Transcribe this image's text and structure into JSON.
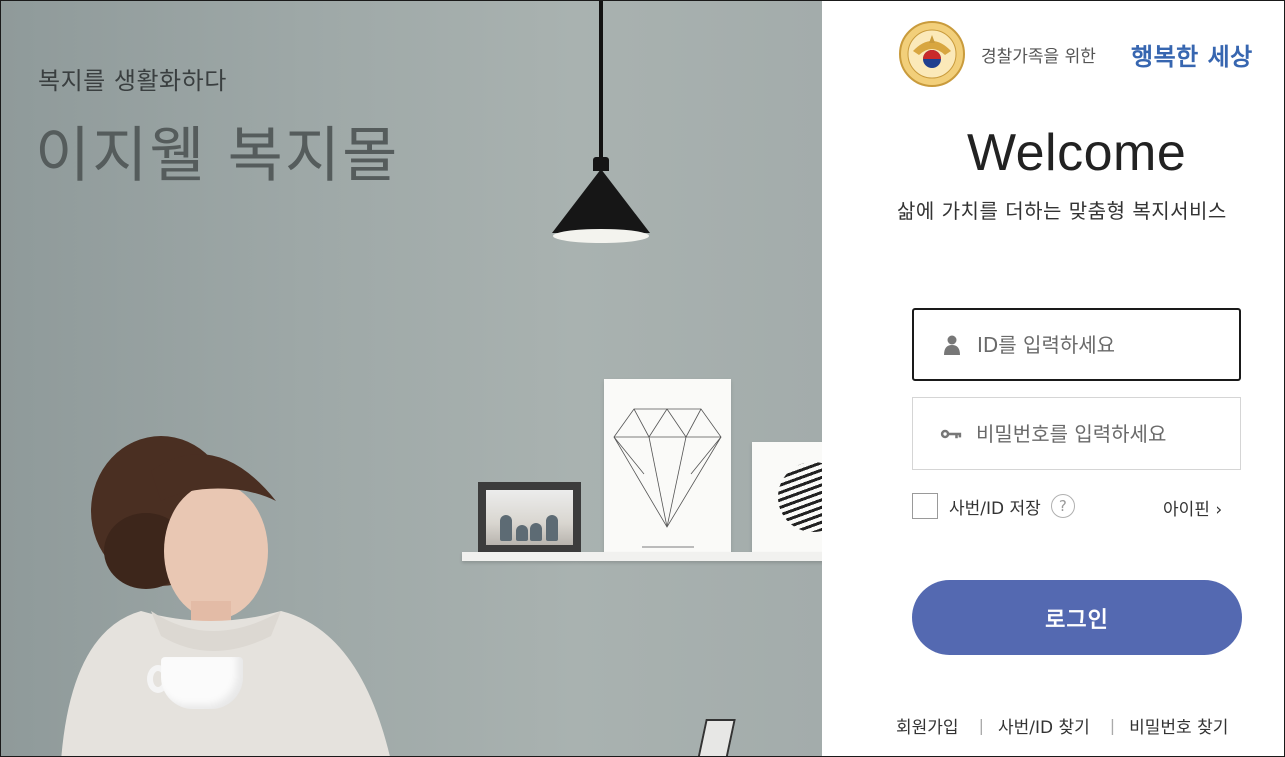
{
  "hero": {
    "subtitle": "복지를 생활화하다",
    "title": "이지웰 복지몰"
  },
  "brand": {
    "emblem_icon": "police-emblem-icon",
    "small_text": "경찰가족을 위한",
    "big_text": "행복한 세상",
    "big_text_color": "#3766b0"
  },
  "login": {
    "welcome": "Welcome",
    "tagline": "삶에 가치를 더하는 맞춤형 복지서비스",
    "id_placeholder": "ID를 입력하세요",
    "pw_placeholder": "비밀번호를 입력하세요",
    "id_icon": "user-icon",
    "pw_icon": "key-icon",
    "save_label": "사번/ID 저장",
    "help_icon": "question-icon",
    "help_glyph": "?",
    "ipin_label": "아이핀 ›",
    "login_button": "로그인",
    "button_color": "#5469b1"
  },
  "footer": {
    "links": [
      "회원가입",
      "사번/ID 찾기",
      "비밀번호 찾기"
    ],
    "separator": "|"
  }
}
